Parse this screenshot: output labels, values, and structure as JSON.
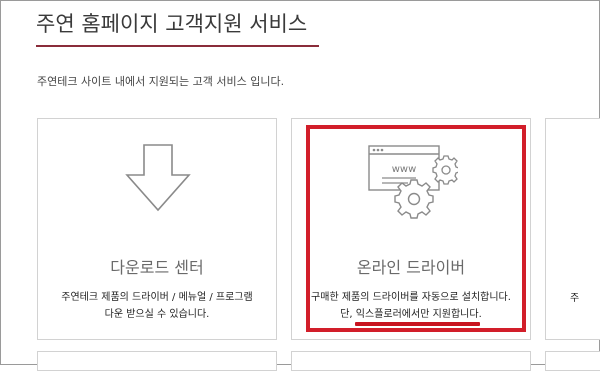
{
  "header": {
    "title": "주연 홈페이지 고객지원 서비스",
    "subtitle": "주연테크 사이트 내에서 지원되는 고객 서비스 입니다."
  },
  "cards": [
    {
      "icon": "download-arrow-icon",
      "title": "다운로드 센터",
      "desc_line1": "주연테크 제품의 드라이버 / 메뉴얼 / 프로그램",
      "desc_line2": "다운 받으실 수 있습니다."
    },
    {
      "icon": "browser-gears-icon",
      "icon_text": "www",
      "title": "온라인 드라이버",
      "desc_line1": "구매한 제품의 드라이버를 자동으로 설치합니다.",
      "desc_line2": "단, 익스플로러에서만 지원합니다."
    },
    {
      "desc_partial": "주"
    }
  ],
  "annotation": {
    "highlight_color": "#d21e2a"
  },
  "colors": {
    "title_rule": "#8a2c3a",
    "card_border": "#d2d2d2"
  }
}
